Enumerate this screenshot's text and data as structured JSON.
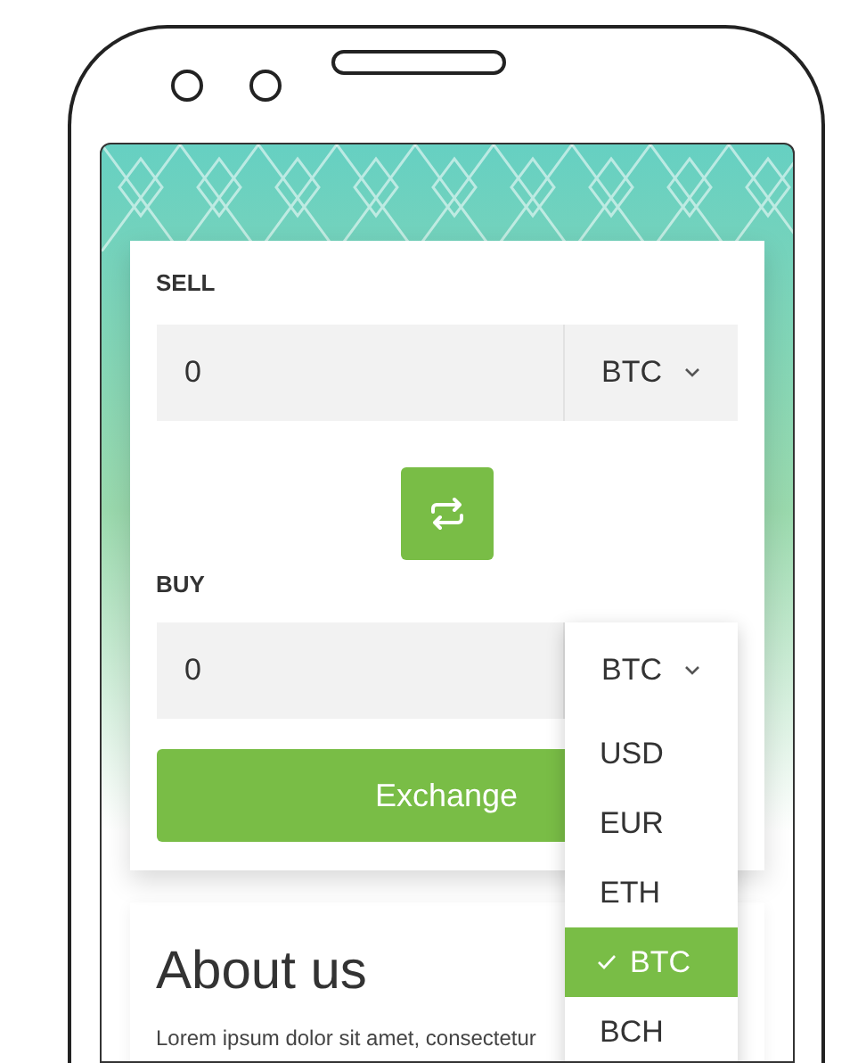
{
  "sell": {
    "label": "SELL",
    "value": "0",
    "currency": "BTC"
  },
  "buy": {
    "label": "BUY",
    "value": "0",
    "currency": "BTC",
    "dropdown": {
      "expanded": true,
      "options": [
        {
          "label": "USD",
          "selected": false
        },
        {
          "label": "EUR",
          "selected": false
        },
        {
          "label": "ETH",
          "selected": false
        },
        {
          "label": "BTC",
          "selected": true
        },
        {
          "label": "BCH",
          "selected": false
        }
      ]
    }
  },
  "exchange_button": "Exchange",
  "about": {
    "heading": "About us",
    "text": "Lorem ipsum dolor sit amet, consectetur"
  }
}
